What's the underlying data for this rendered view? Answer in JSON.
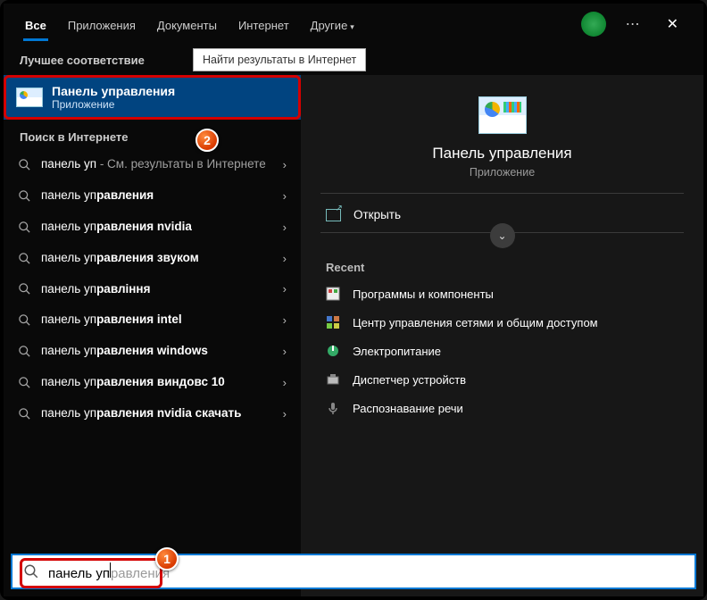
{
  "tabs": {
    "all": "Все",
    "apps": "Приложения",
    "docs": "Документы",
    "web": "Интернет",
    "more": "Другие"
  },
  "header": {
    "best_match_label": "Лучшее соответствие",
    "hint": "Найти результаты в Интернет"
  },
  "best": {
    "title": "Панель управления",
    "subtitle": "Приложение"
  },
  "web_search": {
    "label": "Поиск в Интернете",
    "items": [
      {
        "pre": "панель уп",
        "bold": "",
        "tail": " - См. результаты в Интернете",
        "tail_faint": true
      },
      {
        "pre": "панель уп",
        "bold": "равления",
        "tail": ""
      },
      {
        "pre": "панель уп",
        "bold": "равления nvidia",
        "tail": ""
      },
      {
        "pre": "панель уп",
        "bold": "равления звуком",
        "tail": ""
      },
      {
        "pre": "панель уп",
        "bold": "равління",
        "tail": ""
      },
      {
        "pre": "панель уп",
        "bold": "равления intel",
        "tail": ""
      },
      {
        "pre": "панель уп",
        "bold": "равления windows",
        "tail": ""
      },
      {
        "pre": "панель уп",
        "bold": "равления виндовс 10",
        "tail": ""
      },
      {
        "pre": "панель уп",
        "bold": "равления nvidia скачать",
        "tail": ""
      }
    ]
  },
  "detail": {
    "title": "Панель управления",
    "subtitle": "Приложение",
    "open_label": "Открыть",
    "recent_label": "Recent",
    "recent": [
      "Программы и компоненты",
      "Центр управления сетями и общим доступом",
      "Электропитание",
      "Диспетчер устройств",
      "Распознавание речи"
    ]
  },
  "search": {
    "typed": "панель уп",
    "ghost": "равления"
  },
  "annotations": {
    "badge1": "1",
    "badge2": "2"
  }
}
